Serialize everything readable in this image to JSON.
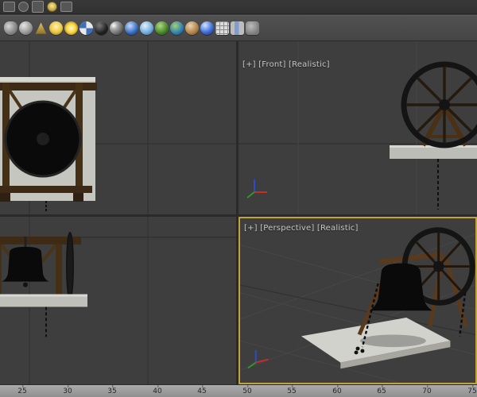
{
  "toolbars": {
    "row1_icons": [
      "viewport-cube-icon",
      "shapes-icon",
      "cylinder-icon",
      "light-icon",
      "helpers-icon"
    ],
    "row2_icons": [
      "teapot-icon",
      "sphere-icon",
      "cone-icon",
      "lightbulb-icon",
      "sun-icon",
      "checker-sphere-icon",
      "dark-sphere-icon",
      "particle-sphere-icon",
      "atom-sphere-icon",
      "water-sphere-icon",
      "foliage-sphere-icon",
      "earth-sphere-icon",
      "shell-sphere-icon",
      "blue-sphere-icon",
      "render-grid-icon",
      "column-settings-icon",
      "layer-badge-icon"
    ]
  },
  "viewports": {
    "front_label": "[+] [Front] [Realistic]",
    "perspective_label": "[+] [Perspective] [Realistic]"
  },
  "timeline": {
    "ticks": [
      "25",
      "30",
      "35",
      "40",
      "45",
      "50",
      "55",
      "60",
      "65",
      "70",
      "75"
    ]
  },
  "colors": {
    "active_viewport_border": "#c0a43a",
    "viewport_background": "#3e3e3e"
  }
}
